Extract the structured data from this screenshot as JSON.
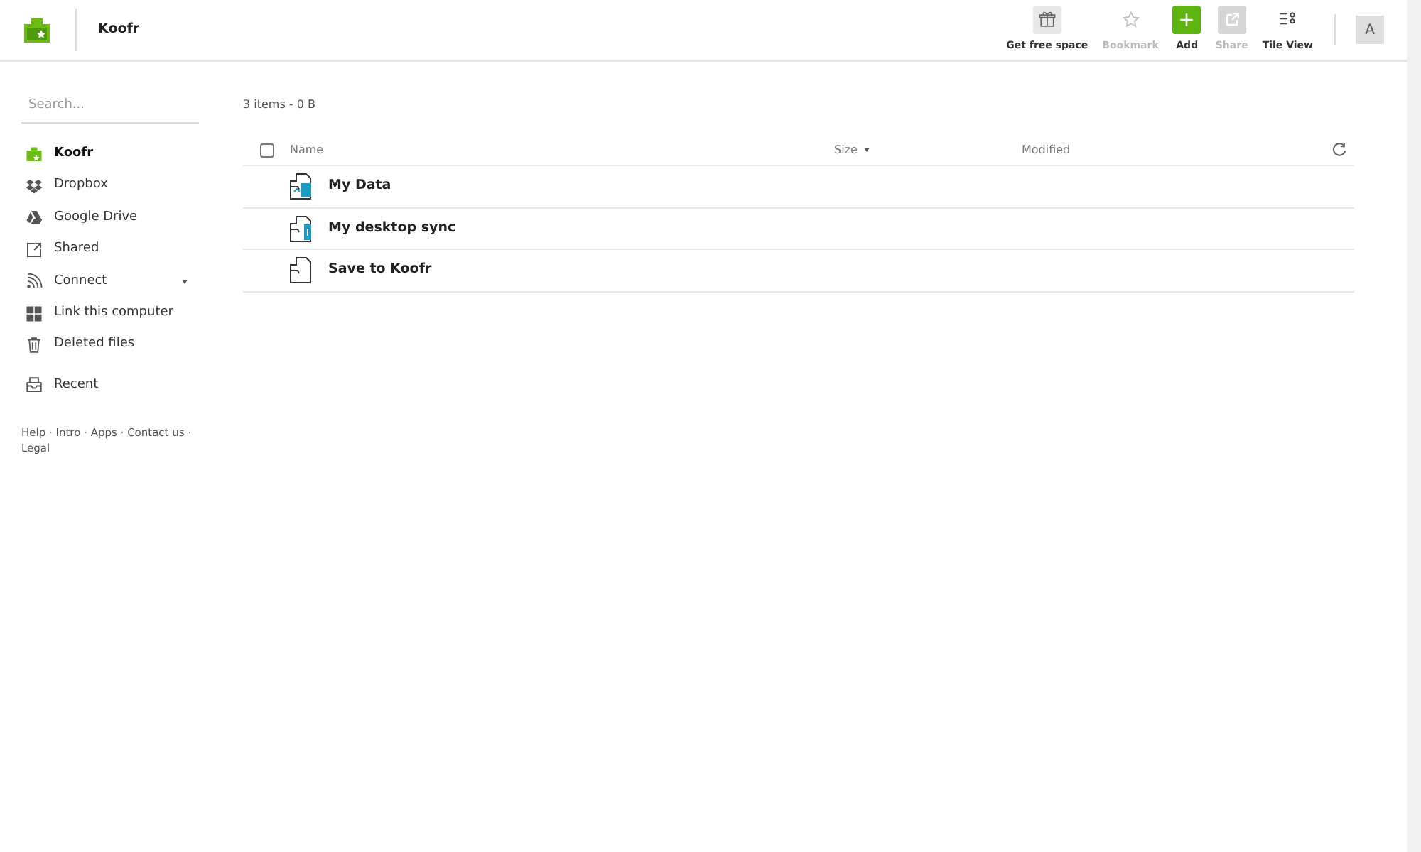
{
  "header": {
    "title": "Koofr"
  },
  "toolbar": [
    {
      "kind": "gift",
      "label": "Get free space",
      "disabled": false
    },
    {
      "kind": "star",
      "label": "Bookmark",
      "disabled": true
    },
    {
      "kind": "add",
      "label": "Add",
      "disabled": false
    },
    {
      "kind": "share",
      "label": "Share",
      "disabled": true
    },
    {
      "kind": "tiles",
      "label": "Tile View",
      "disabled": false
    }
  ],
  "avatar": "A",
  "sidebar": {
    "search_placeholder": "Search...",
    "items": [
      {
        "kind": "koofr",
        "label": "Koofr",
        "selected": true,
        "dropdown": false
      },
      {
        "kind": "dropbox",
        "label": "Dropbox",
        "selected": false,
        "dropdown": false
      },
      {
        "kind": "drive",
        "label": "Google Drive",
        "selected": false,
        "dropdown": false
      },
      {
        "kind": "shared",
        "label": "Shared",
        "selected": false,
        "dropdown": false
      },
      {
        "kind": "connect",
        "label": "Connect",
        "selected": false,
        "dropdown": true
      },
      {
        "kind": "computer",
        "label": "Link this computer",
        "selected": false,
        "dropdown": false
      },
      {
        "kind": "trash",
        "label": "Deleted files",
        "selected": false,
        "dropdown": false
      },
      {
        "kind": "recent",
        "label": "Recent",
        "selected": false,
        "dropdown": false
      }
    ],
    "footer_links": [
      "Help",
      "Intro",
      "Apps",
      "Contact us",
      "Legal"
    ],
    "footer_separator": "·"
  },
  "summary": "3 items - 0 B",
  "table": {
    "select_all_checked": false,
    "columns": [
      "Name",
      "Size",
      "Modified"
    ],
    "rows": [
      {
        "kind": "data",
        "name": "My Data"
      },
      {
        "kind": "sync",
        "name": "My desktop sync"
      },
      {
        "kind": "plain",
        "name": "Save to Koofr"
      }
    ]
  }
}
